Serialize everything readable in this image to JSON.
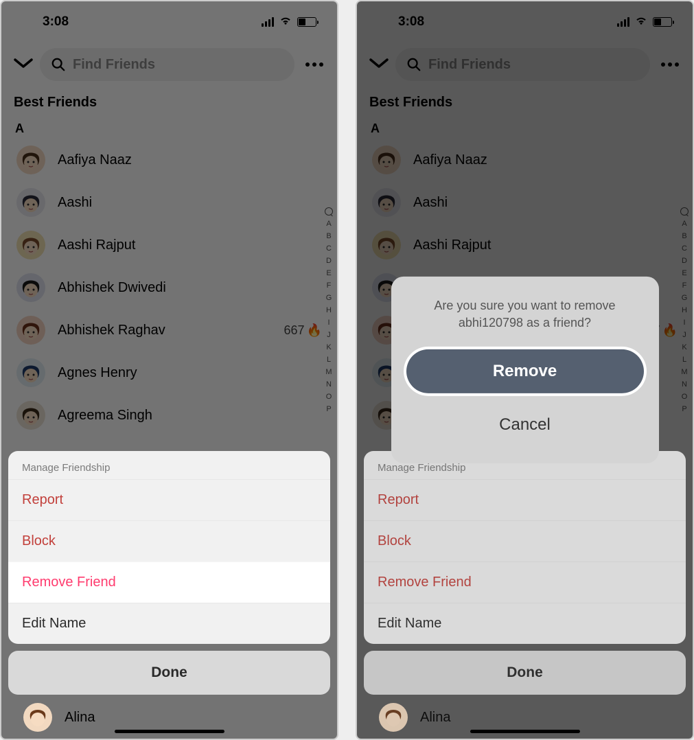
{
  "status": {
    "time": "3:08"
  },
  "search": {
    "placeholder": "Find Friends"
  },
  "sections": {
    "top": "Best Friends",
    "letter": "A"
  },
  "friends": [
    {
      "name": "Aafiya Naaz"
    },
    {
      "name": "Aashi"
    },
    {
      "name": "Aashi Rajput"
    },
    {
      "name": "Abhishek Dwivedi"
    },
    {
      "name": "Abhishek Raghav",
      "streak": "667"
    },
    {
      "name": "Agnes Henry"
    },
    {
      "name": "Agreema Singh"
    }
  ],
  "bottom_friend": {
    "name": "Alina"
  },
  "index": [
    "A",
    "B",
    "C",
    "D",
    "E",
    "F",
    "G",
    "H",
    "I",
    "J",
    "K",
    "L",
    "M",
    "N",
    "O",
    "P"
  ],
  "sheet": {
    "title": "Manage Friendship",
    "report": "Report",
    "block": "Block",
    "remove": "Remove Friend",
    "edit": "Edit Name",
    "done": "Done"
  },
  "confirm": {
    "line1": "Are you sure you want to remove",
    "line2": "abhi120798 as a friend?",
    "remove": "Remove",
    "cancel": "Cancel"
  },
  "avatar_colors": [
    {
      "bg": "#f3d9c4",
      "hair": "#4a2f1a"
    },
    {
      "bg": "#e9e9f0",
      "hair": "#2b2b3a"
    },
    {
      "bg": "#f2e2b3",
      "hair": "#7b4a2a"
    },
    {
      "bg": "#dfe3f0",
      "hair": "#1a1a1a"
    },
    {
      "bg": "#f4d2c2",
      "hair": "#6b2f1a"
    },
    {
      "bg": "#e2eef4",
      "hair": "#1e3a6b"
    },
    {
      "bg": "#ece3d6",
      "hair": "#3a2a1a"
    }
  ]
}
